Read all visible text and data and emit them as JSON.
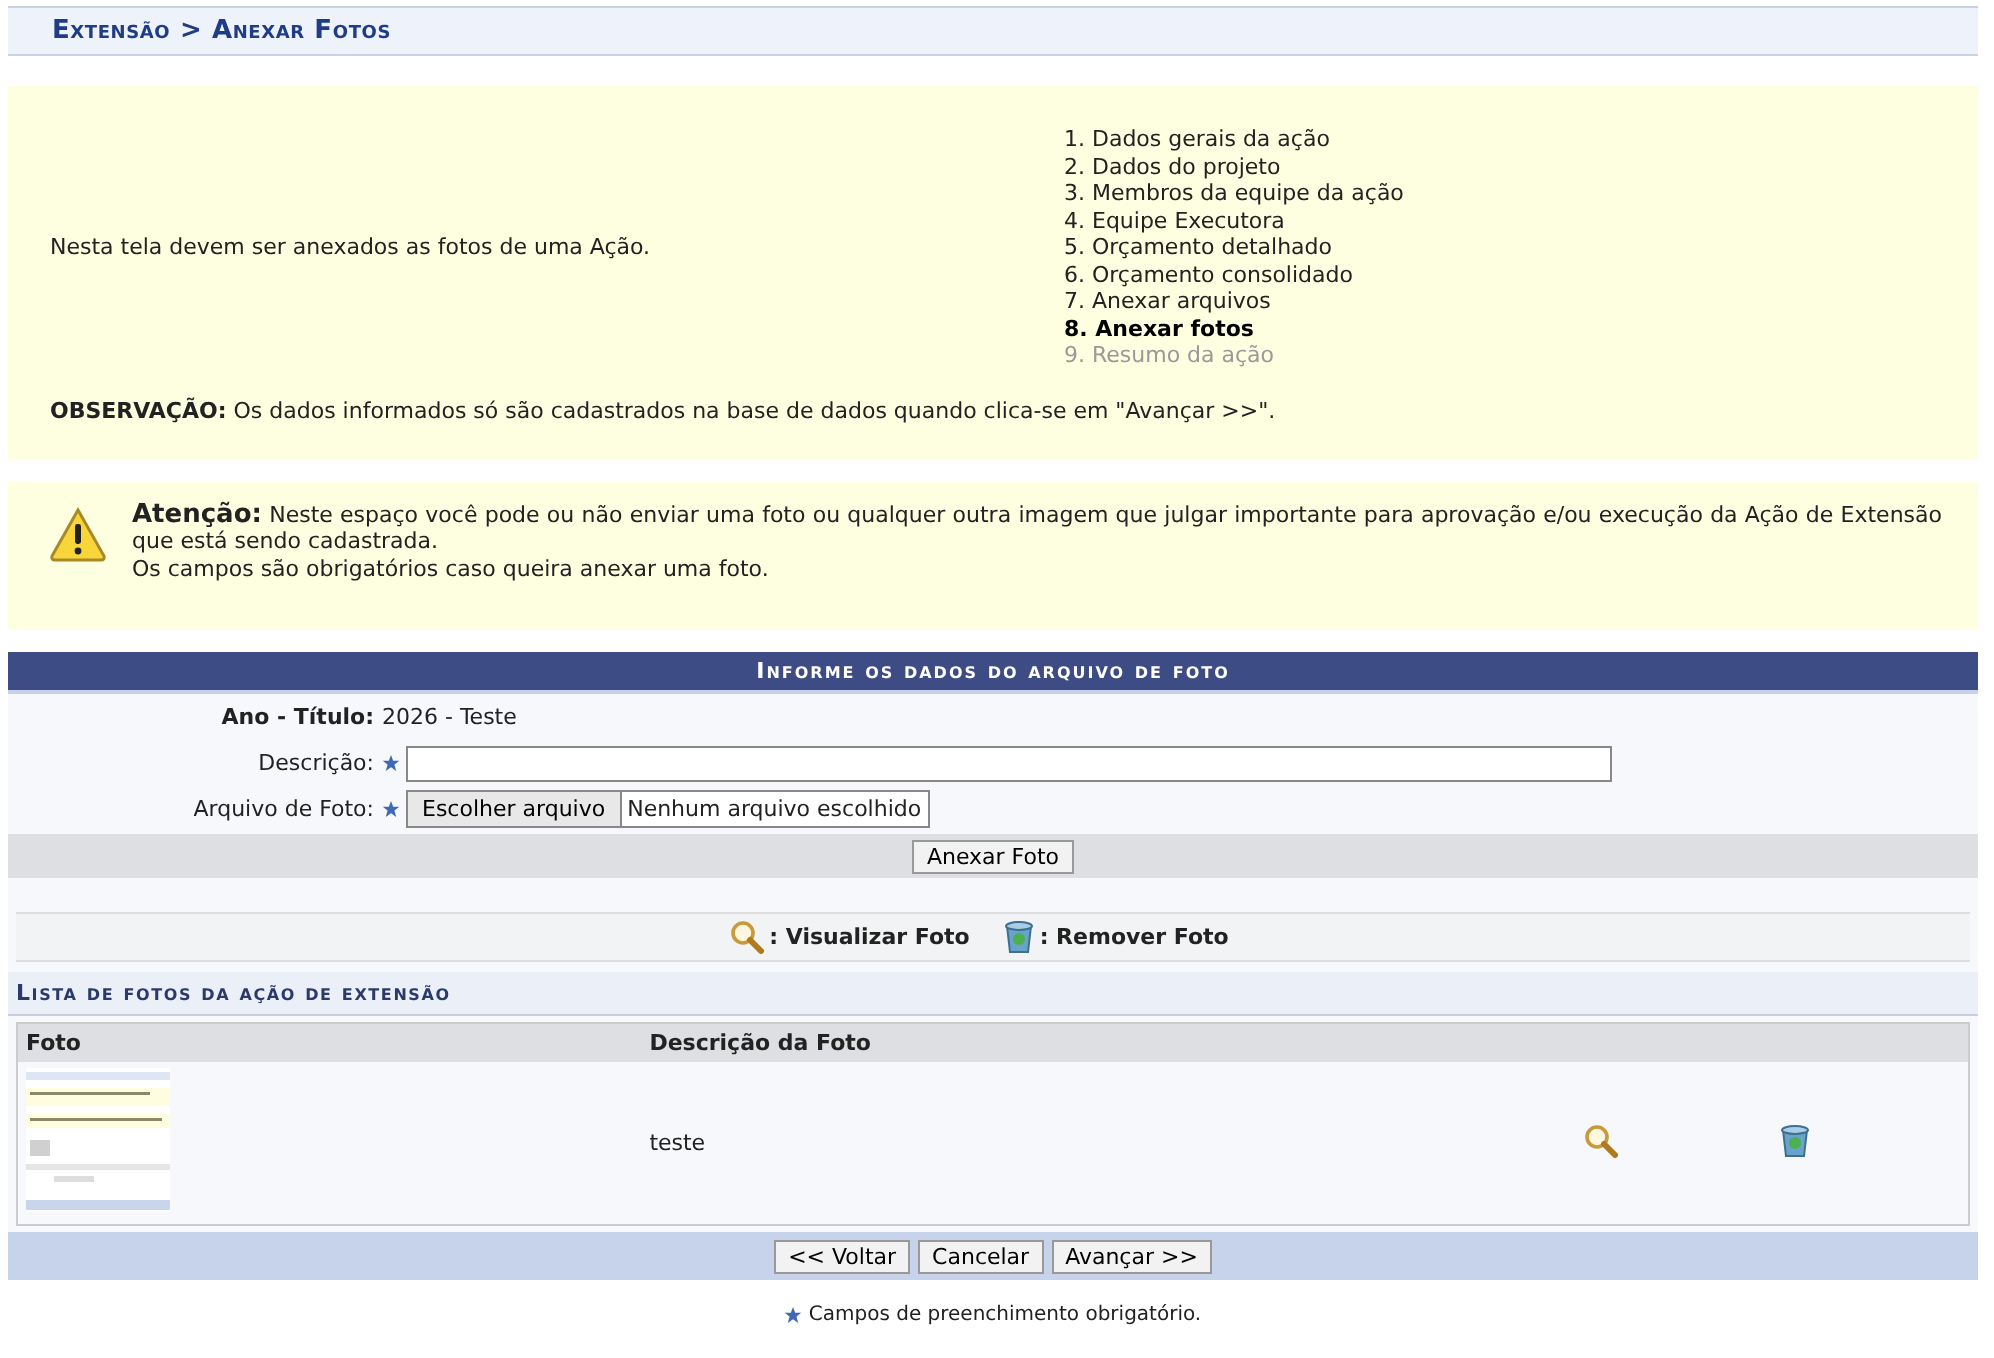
{
  "breadcrumb": "Extensão > Anexar Fotos",
  "intro": {
    "text": "Nesta tela devem ser anexados as fotos de uma Ação.",
    "steps": [
      {
        "label": "1. Dados gerais da ação",
        "selected": false,
        "disabled": false
      },
      {
        "label": "2. Dados do projeto",
        "selected": false,
        "disabled": false
      },
      {
        "label": "3. Membros da equipe da ação",
        "selected": false,
        "disabled": false
      },
      {
        "label": "4. Equipe Executora",
        "selected": false,
        "disabled": false
      },
      {
        "label": "5. Orçamento detalhado",
        "selected": false,
        "disabled": false
      },
      {
        "label": "6. Orçamento consolidado",
        "selected": false,
        "disabled": false
      },
      {
        "label": "7. Anexar arquivos",
        "selected": false,
        "disabled": false
      },
      {
        "label": "8. Anexar fotos",
        "selected": true,
        "disabled": false
      },
      {
        "label": "9. Resumo da ação",
        "selected": false,
        "disabled": true
      }
    ],
    "note": "**OBSERVAÇÃO:** Os dados informados só são cadastrados na base de dados quando clica-se em \"Avançar >>\"."
  },
  "warning": {
    "lines": [
      "**Atenção:** Neste espaço você pode ou não enviar uma foto ou qualquer outra imagem que julgar importante para aprovação e/ou execução da Ação de Extensão que está sendo cadastrada.",
      "Os campos são obrigatórios caso queira anexar uma foto."
    ]
  },
  "form": {
    "title": "Informe os dados do arquivo de foto",
    "year_label": "Ano - Título:",
    "year_value": "2026 - Teste",
    "description_label": "Descrição:",
    "file_label": "Arquivo de Foto:",
    "file_button": "Escolher arquivo",
    "file_status": "Nenhum arquivo escolhido",
    "submit": "Anexar Foto"
  },
  "legend": [
    {
      "kind": "view",
      "label": ": Visualizar Foto"
    },
    {
      "kind": "remove",
      "label": ": Remover Foto"
    }
  ],
  "list": {
    "title": "Lista de fotos da ação de extensão",
    "columns": [
      "Foto",
      "Descrição da Foto"
    ],
    "rows": [
      {
        "description": "teste"
      }
    ]
  },
  "buttons": [
    "<< Voltar",
    "Cancelar",
    "Avançar >>"
  ],
  "required_note": "Campos de preenchimento obrigatório."
}
